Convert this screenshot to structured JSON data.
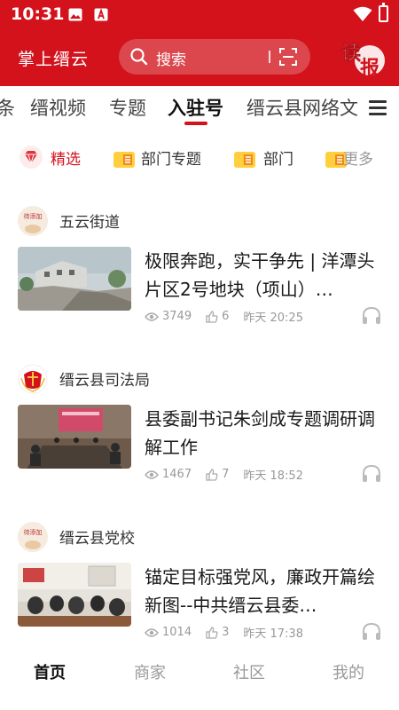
{
  "status_bar": {
    "time": "10:31",
    "icons": [
      "image-icon",
      "a-notification-icon",
      "wifi-icon",
      "battery-icon"
    ]
  },
  "header": {
    "brand": "掌上缙云",
    "search_placeholder": "搜索",
    "read_button": "读报",
    "accent_color": "#d3121c"
  },
  "tabs": {
    "items": [
      "条",
      "缙视频",
      "专题",
      "入驻号",
      "缙云县网络文"
    ],
    "active": "入驻号"
  },
  "subtabs": {
    "featured": "精选",
    "dept_topics": "部门专题",
    "dept": "部门",
    "more": "更多"
  },
  "feed": [
    {
      "source": "五云街道",
      "avatar_text": "待添加",
      "title": "极限奔跑，实干争先 | 洋潭头片区2号地块（项山）…",
      "views": "3749",
      "likes": "6",
      "time": "昨天 20:25"
    },
    {
      "source": "缙云县司法局",
      "avatar_text": "",
      "title": "县委副书记朱剑成专题调研调解工作",
      "views": "1467",
      "likes": "7",
      "time": "昨天 18:52"
    },
    {
      "source": "缙云县党校",
      "avatar_text": "待添加",
      "title": "锚定目标强党风，廉政开篇绘新图--中共缙云县委…",
      "views": "1014",
      "likes": "3",
      "time": "昨天 17:38"
    }
  ],
  "bottom_nav": {
    "items": [
      "首页",
      "商家",
      "社区",
      "我的"
    ],
    "active": "首页"
  }
}
